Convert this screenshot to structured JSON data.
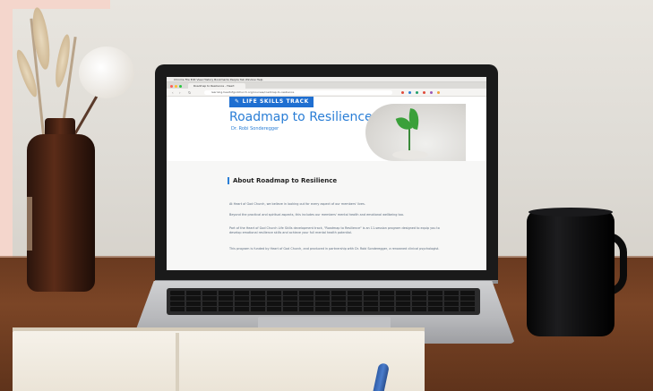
{
  "browser": {
    "menubar_text": "Chrome  File  Edit  View  History  Bookmarks  People  Tab  Window  Help",
    "tab_title": "Roadmap to Resilience - Heart",
    "url": "learning.heartofgodchurch.org/courses/roadmap-to-resilience"
  },
  "page": {
    "badge": "LIFE SKILLS TRACK",
    "title": "Roadmap to Resilience",
    "subtitle": "Dr. Robi Sonderegger",
    "section_heading": "About Roadmap to Resilience",
    "paragraphs": [
      "At Heart of God Church, we believe in looking out for every aspect of our members' lives.",
      "Beyond the practical and spiritual aspects, this includes our members' mental health and emotional wellbeing too.",
      "Part of the Heart of God Church Life Skills development track, \"Roadmap to Resilience\" is an 11-session program designed to equip you to develop emotional resilience skills and achieve your full mental health potential.",
      "This program is funded by Heart of God Church, and produced in partnership with Dr. Robi Sonderegger, a renowned clinical psychologist."
    ]
  },
  "colors": {
    "accent": "#1f6fd1",
    "title": "#2a7ed6",
    "mug": "#0c0c0d",
    "table": "#6a3a20"
  }
}
